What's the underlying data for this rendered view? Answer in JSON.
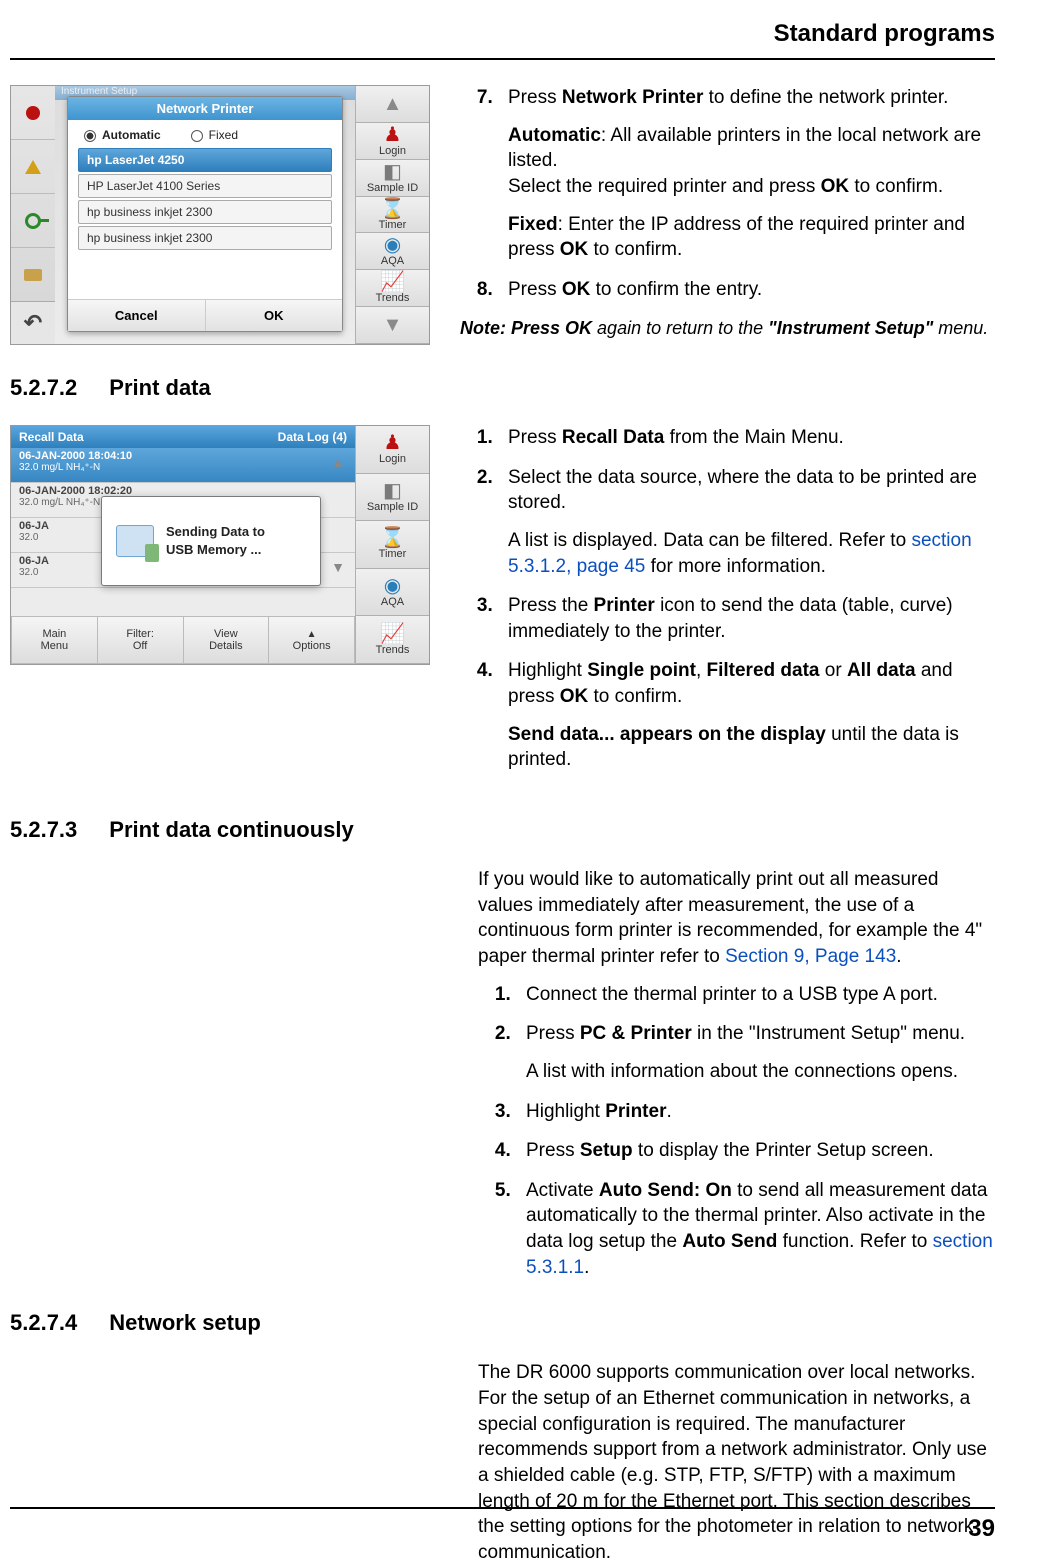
{
  "running_head": "Standard programs",
  "page_number": "39",
  "fig1": {
    "behind_title": "Instrument Setup",
    "dialog_title": "Network Printer",
    "radio_automatic": "Automatic",
    "radio_fixed": "Fixed",
    "printers": [
      "hp LaserJet 4250",
      "HP LaserJet 4100 Series",
      "hp business inkjet 2300",
      "hp business inkjet 2300"
    ],
    "btn_cancel": "Cancel",
    "btn_ok": "OK",
    "right": {
      "login": "Login",
      "sampleid": "Sample ID",
      "timer": "Timer",
      "aqa": "AQA",
      "trends": "Trends"
    }
  },
  "s5271": {
    "step7_a": "Press ",
    "step7_b": "Network Printer",
    "step7_c": " to define the network printer.",
    "auto_lead": "Automatic",
    "auto_rest": ": All available printers in the local network are listed.",
    "auto_line2a": "Select the required printer and press ",
    "auto_line2b": "OK",
    "auto_line2c": " to confirm.",
    "fixed_lead": "Fixed",
    "fixed_rest_a": ": Enter the IP address of the required printer and press ",
    "fixed_rest_b": "OK",
    "fixed_rest_c": " to confirm.",
    "step8_a": "Press ",
    "step8_b": "OK",
    "step8_c": " to confirm the entry.",
    "note_a": "Note: Press ",
    "note_b": "OK",
    "note_c": " again to return to the ",
    "note_d": "\"Instrument Setup\"",
    "note_e": " menu."
  },
  "h5272": {
    "num": "5.2.7.2",
    "title": "Print data"
  },
  "fig2": {
    "hdr_left": "Recall Data",
    "hdr_right": "Data Log (4)",
    "rows": [
      {
        "l1": "06-JAN-2000  18:04:10",
        "l2": "32.0  mg/L  NH₄⁺-N"
      },
      {
        "l1": "06-JAN-2000  18:02:20",
        "l2": "32.0  mg/L  NH₄⁺-N"
      },
      {
        "l1": "06-JA",
        "l2": "32.0"
      },
      {
        "l1": "06-JA",
        "l2": "32.0"
      }
    ],
    "send1": "Sending Data to",
    "send2": "USB Memory ...",
    "bb_main1": "Main",
    "bb_main2": "Menu",
    "bb_filter1": "Filter:",
    "bb_filter2": "Off",
    "bb_view1": "View",
    "bb_view2": "Details",
    "bb_options": "Options",
    "right": {
      "login": "Login",
      "sampleid": "Sample ID",
      "timer": "Timer",
      "aqa": "AQA",
      "trends": "Trends"
    }
  },
  "s5272": {
    "step1_a": "Press ",
    "step1_b": "Recall Data",
    "step1_c": " from the Main Menu.",
    "step2": "Select the data source, where the data to be printed are stored.",
    "step2_sub_a": "A list is displayed. Data can be filtered. Refer to ",
    "step2_sub_link": "section 5.3.1.2, page 45",
    "step2_sub_b": " for more information.",
    "step3_a": "Press the ",
    "step3_b": "Printer",
    "step3_c": " icon to send the data (table, curve) immediately to the printer.",
    "step4_a": "Highlight ",
    "step4_b": "Single point",
    "step4_c": ", ",
    "step4_d": "Filtered data",
    "step4_e": " or ",
    "step4_f": "All data",
    "step4_g": " and press ",
    "step4_h": "OK",
    "step4_i": " to confirm.",
    "step4_sub_a": "Send data... appears on the display",
    "step4_sub_b": " until the data is printed."
  },
  "h5273": {
    "num": "5.2.7.3",
    "title": "Print data continuously"
  },
  "s5273": {
    "intro_a": "If you would like to automatically print out all measured values immediately after measurement, the use of a continuous form printer is recommended, for example the 4\" paper thermal printer refer to ",
    "intro_link": "Section 9, Page 143",
    "intro_b": ".",
    "step1": "Connect the thermal printer to a USB type A port.",
    "step2_a": "Press ",
    "step2_b": "PC & Printer",
    "step2_c": " in the \"Instrument Setup\" menu.",
    "step2_sub": "A list with information about the connections opens.",
    "step3_a": "Highlight ",
    "step3_b": "Printer",
    "step3_c": ".",
    "step4_a": "Press ",
    "step4_b": "Setup",
    "step4_c": " to display the Printer Setup screen.",
    "step5_a": "Activate ",
    "step5_b": "Auto Send: On",
    "step5_c": " to send all measurement data automatically to the thermal printer. Also activate in the data log setup the ",
    "step5_d": "Auto Send",
    "step5_e": " function. Refer to ",
    "step5_link": "section 5.3.1.1",
    "step5_f": "."
  },
  "h5274": {
    "num": "5.2.7.4",
    "title": "Network setup"
  },
  "s5274": {
    "para": "The DR 6000 supports communication over local networks. For the setup of an Ethernet communication in networks, a special configuration is required. The manufacturer recommends support from a network administrator. Only use a shielded cable (e.g. STP, FTP, S/FTP) with a maximum length of 20 m for the Ethernet port. This section describes the setting options for the photometer in relation to network communication."
  }
}
